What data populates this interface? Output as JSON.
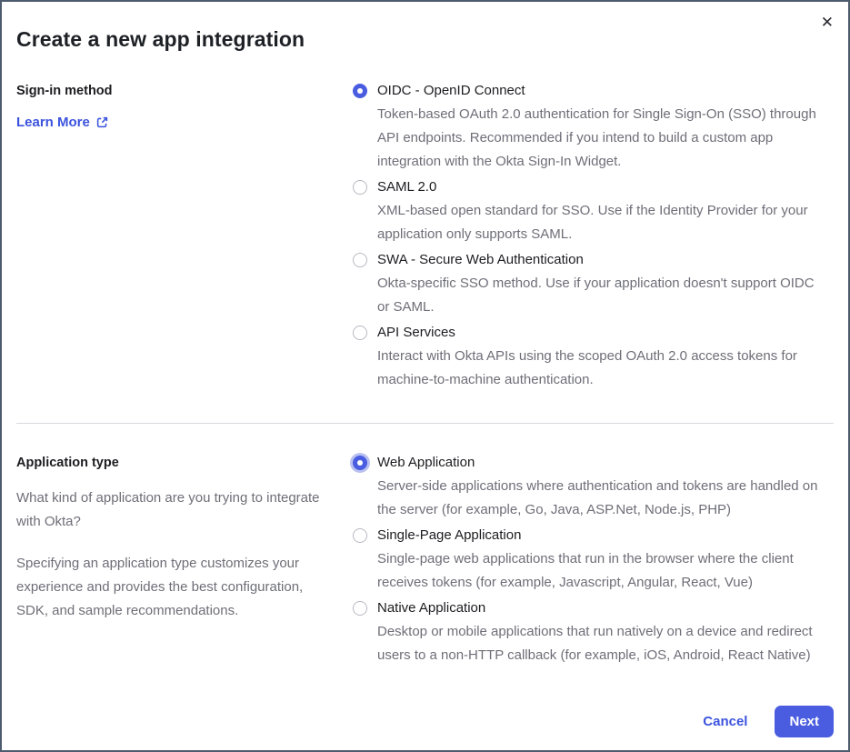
{
  "modal": {
    "title": "Create a new app integration",
    "close_label": "✕"
  },
  "signin_section": {
    "label": "Sign-in method",
    "learn_more_label": "Learn More",
    "options": [
      {
        "label": "OIDC - OpenID Connect",
        "description": "Token-based OAuth 2.0 authentication for Single Sign-On (SSO) through API endpoints. Recommended if you intend to build a custom app integration with the Okta Sign-In Widget.",
        "selected": true
      },
      {
        "label": "SAML 2.0",
        "description": "XML-based open standard for SSO. Use if the Identity Provider for your application only supports SAML.",
        "selected": false
      },
      {
        "label": "SWA - Secure Web Authentication",
        "description": "Okta-specific SSO method. Use if your application doesn't support OIDC or SAML.",
        "selected": false
      },
      {
        "label": "API Services",
        "description": "Interact with Okta APIs using the scoped OAuth 2.0 access tokens for machine-to-machine authentication.",
        "selected": false
      }
    ]
  },
  "apptype_section": {
    "label": "Application type",
    "question": "What kind of application are you trying to integrate with Okta?",
    "hint": "Specifying an application type customizes your experience and provides the best configuration, SDK, and sample recommendations.",
    "options": [
      {
        "label": "Web Application",
        "description": "Server-side applications where authentication and tokens are handled on the server (for example, Go, Java, ASP.Net, Node.js, PHP)",
        "selected": true,
        "focused": true
      },
      {
        "label": "Single-Page Application",
        "description": "Single-page web applications that run in the browser where the client receives tokens (for example, Javascript, Angular, React, Vue)",
        "selected": false
      },
      {
        "label": "Native Application",
        "description": "Desktop or mobile applications that run natively on a device and redirect users to a non-HTTP callback (for example, iOS, Android, React Native)",
        "selected": false
      }
    ]
  },
  "footer": {
    "cancel_label": "Cancel",
    "next_label": "Next"
  },
  "colors": {
    "accent": "#4a5ce0",
    "link": "#3c53de",
    "frame_border": "#4d5b6e",
    "text_primary": "#1d1d21",
    "text_secondary": "#6e6e78",
    "divider": "#d8d8dd",
    "focus_halo": "#b9c0f0"
  }
}
